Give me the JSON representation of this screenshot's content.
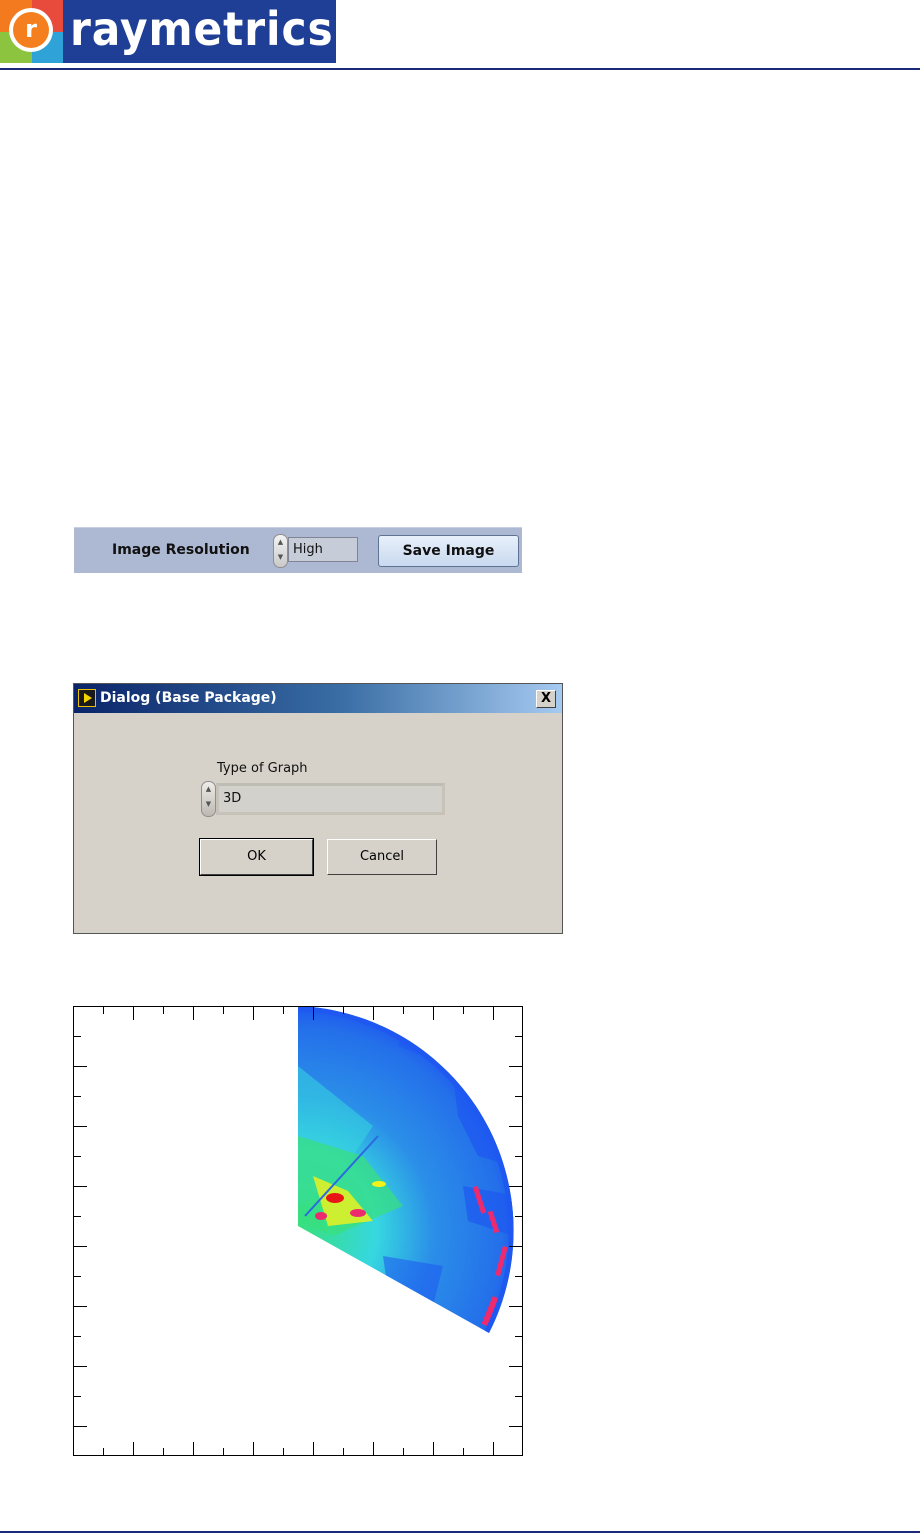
{
  "logo": {
    "text": "raymetrics",
    "mark": "r"
  },
  "save_toolbar": {
    "label": "Image Resolution",
    "value": "High",
    "button": "Save Image"
  },
  "dialog": {
    "title": "Dialog (Base Package)",
    "close": "X",
    "field_label": "Type of Graph",
    "field_value": "3D",
    "ok": "OK",
    "cancel": "Cancel"
  },
  "colors": {
    "rule": "#1c2a7a",
    "toolbar_bg": "#adb9d2",
    "dialog_bg": "#d6d2ca",
    "plot_palette": [
      "#1e58f0",
      "#2b8fe8",
      "#36d7e0",
      "#38e07a",
      "#f2f21a",
      "#ee2a6f",
      "#e81616"
    ]
  },
  "icons": [
    "spinner-icon",
    "labview-app-icon",
    "close-icon"
  ]
}
